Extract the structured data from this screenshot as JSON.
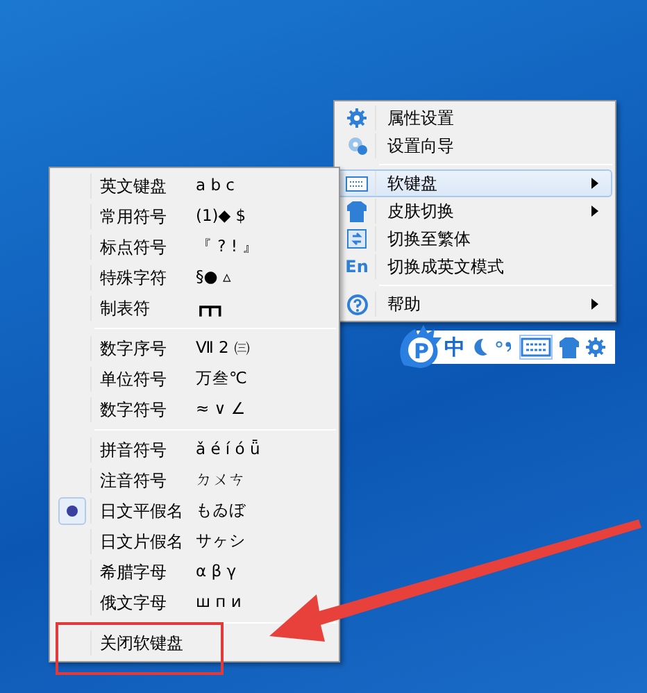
{
  "context_menu": {
    "groups": [
      [
        {
          "kind": "gear",
          "label": "属性设置",
          "submenu": false,
          "selected": false
        },
        {
          "kind": "gears",
          "label": "设置向导",
          "submenu": false,
          "selected": false
        }
      ],
      [
        {
          "kind": "keyboard",
          "label": "软键盘",
          "submenu": true,
          "selected": true
        },
        {
          "kind": "shirt",
          "label": "皮肤切换",
          "submenu": true,
          "selected": false
        },
        {
          "kind": "convert",
          "label": "切换至繁体",
          "submenu": false,
          "selected": false
        },
        {
          "kind": "text",
          "icon_text": "En",
          "label": "切换成英文模式",
          "submenu": false,
          "selected": false
        }
      ],
      [
        {
          "kind": "help",
          "label": "帮助",
          "submenu": true,
          "selected": false
        }
      ]
    ]
  },
  "soft_keyboard_menu": {
    "groups": [
      [
        {
          "label": "英文键盘",
          "sample": "a b c",
          "selected": false
        },
        {
          "label": "常用符号",
          "sample": "(1)◆ $",
          "selected": false
        },
        {
          "label": "标点符号",
          "sample": "『 ? ! 』",
          "selected": false
        },
        {
          "label": "特殊字符",
          "sample": "§● ▵",
          "selected": false
        },
        {
          "label": "制表符",
          "sample": "┏┳┓",
          "selected": false
        }
      ],
      [
        {
          "label": "数字序号",
          "sample": "Ⅶ 2 ㈢",
          "selected": false
        },
        {
          "label": "单位符号",
          "sample": "万叁℃",
          "selected": false
        },
        {
          "label": "数字符号",
          "sample": "≈ ∨ ∠",
          "selected": false
        }
      ],
      [
        {
          "label": "拼音符号",
          "sample": "ǎ é í ó ǖ",
          "selected": false
        },
        {
          "label": "注音符号",
          "sample": "ㄉㄨㄘ",
          "selected": false
        },
        {
          "label": "日文平假名",
          "sample": "もゐぼ",
          "selected": true
        },
        {
          "label": "日文片假名",
          "sample": "サヶシ",
          "selected": false
        },
        {
          "label": "希腊字母",
          "sample": "α β γ",
          "selected": false
        },
        {
          "label": "俄文字母",
          "sample": "ш п и",
          "selected": false
        }
      ],
      [
        {
          "label": "关闭软键盘",
          "selected": false
        }
      ]
    ]
  },
  "status_bar": {
    "items": [
      {
        "kind": "logo",
        "text": "P"
      },
      {
        "kind": "text",
        "text": "中"
      },
      {
        "kind": "moon"
      },
      {
        "kind": "punct"
      },
      {
        "kind": "keyboard"
      },
      {
        "kind": "shirt"
      },
      {
        "kind": "gear"
      }
    ]
  }
}
